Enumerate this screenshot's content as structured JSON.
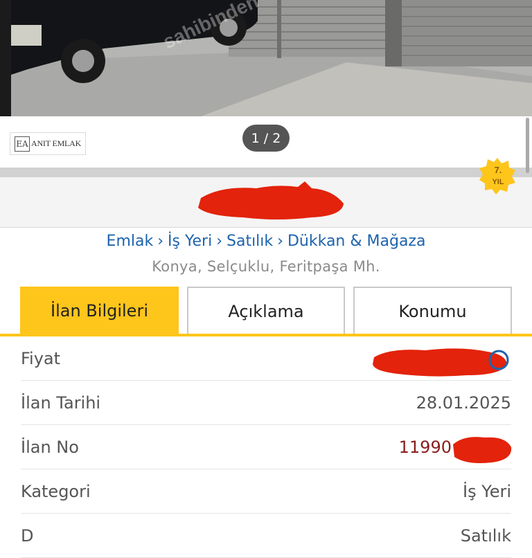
{
  "gallery": {
    "counter": "1 / 2",
    "watermark": "sahibinden",
    "agency_logo_initials": "EA",
    "agency_logo_text": "ANIT EMLAK"
  },
  "badge": {
    "line1": "7.",
    "line2": "YIL"
  },
  "breadcrumb": [
    "Emlak",
    "İş Yeri",
    "Satılık",
    "Dükkan & Mağaza"
  ],
  "location": "Konya, Selçuklu, Feritpaşa Mh.",
  "tabs": [
    {
      "label": "İlan Bilgileri",
      "active": true
    },
    {
      "label": "Açıklama",
      "active": false
    },
    {
      "label": "Konumu",
      "active": false
    }
  ],
  "details": [
    {
      "label": "Fiyat",
      "value": ""
    },
    {
      "label": "İlan Tarihi",
      "value": "28.01.2025"
    },
    {
      "label": "İlan No",
      "value": "11990"
    },
    {
      "label": "Kategori",
      "value": "İş Yeri"
    },
    {
      "label": "D",
      "value": "Satılık"
    }
  ],
  "colors": {
    "accent": "#fec51b",
    "link": "#1e63ad",
    "redaction": "#e3230b",
    "id_red": "#8b1c1c"
  }
}
